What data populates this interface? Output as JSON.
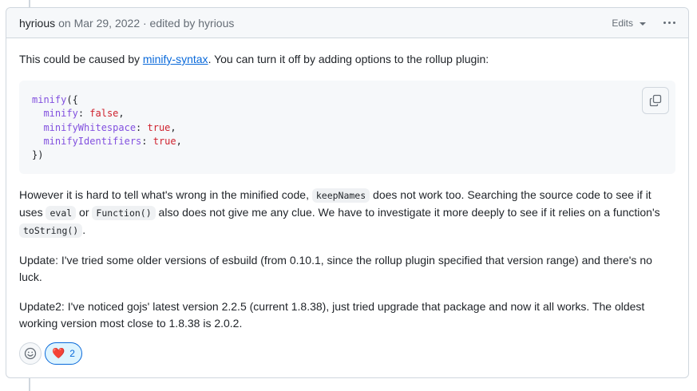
{
  "header": {
    "author": "hyrious",
    "meta": "on Mar 29, 2022 · edited by hyrious",
    "edits_label": "Edits"
  },
  "body": {
    "p1_before": "This could be caused by ",
    "p1_link": "minify-syntax",
    "p1_after": ". You can turn it off by adding options to the rollup plugin:",
    "code_lines": {
      "l1_fn": "minify",
      "l1_rest": "({",
      "l2_key": "minify",
      "l2_val": "false",
      "l3_key": "minifyWhitespace",
      "l3_val": "true",
      "l4_key": "minifyIdentifiers",
      "l4_val": "true",
      "l5": "})"
    },
    "p2_a": "However it is hard to tell what's wrong in the minified code, ",
    "p2_code1": "keepNames",
    "p2_b": " does not work too. Searching the source code to see if it uses ",
    "p2_code2": "eval",
    "p2_c": " or ",
    "p2_code3": "Function()",
    "p2_d": " also does not give me any clue. We have to investigate it more deeply to see if it relies on a function's ",
    "p2_code4": "toString()",
    "p2_e": ".",
    "p3": "Update: I've tried some older versions of esbuild (from 0.10.1, since the rollup plugin specified that version range) and there's no luck.",
    "p4": "Update2: I've noticed gojs' latest version 2.2.5 (current 1.8.38), just tried upgrade that package and now it all works. The oldest working version most close to 1.8.38 is 2.0.2."
  },
  "reactions": {
    "add_icon": "smiley-icon",
    "heart_glyph": "❤️",
    "heart_count": "2"
  }
}
